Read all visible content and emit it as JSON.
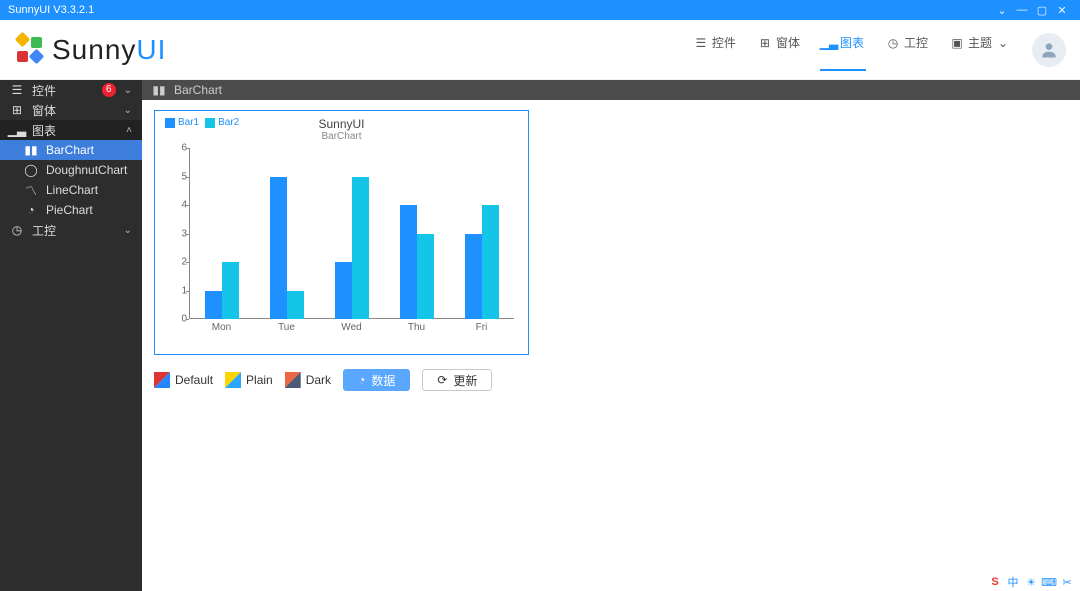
{
  "titlebar": {
    "title": "SunnyUI V3.3.2.1"
  },
  "logo": {
    "text1": "Sunny",
    "text2": "UI"
  },
  "topnav": {
    "items": [
      {
        "label": "控件",
        "icon": "grid-icon"
      },
      {
        "label": "窗体",
        "icon": "window-icon"
      },
      {
        "label": "图表",
        "icon": "chart-icon",
        "active": true
      },
      {
        "label": "工控",
        "icon": "gauge-icon"
      },
      {
        "label": "主题",
        "icon": "image-icon",
        "dropdown": true
      }
    ]
  },
  "sidebar": {
    "groups": [
      {
        "label": "控件",
        "icon": "grid-icon",
        "badge": "6",
        "expand": "⌄"
      },
      {
        "label": "窗体",
        "icon": "window-icon",
        "expand": "⌄"
      },
      {
        "label": "图表",
        "icon": "chart-icon",
        "expand": "˄",
        "open": true,
        "children": [
          {
            "label": "BarChart",
            "icon": "bar-icon",
            "active": true
          },
          {
            "label": "DoughnutChart",
            "icon": "doughnut-icon"
          },
          {
            "label": "LineChart",
            "icon": "line-icon"
          },
          {
            "label": "PieChart",
            "icon": "pie-icon"
          }
        ]
      },
      {
        "label": "工控",
        "icon": "gauge-icon",
        "expand": "⌄"
      }
    ]
  },
  "breadcrumb": {
    "label": "BarChart"
  },
  "chart_data": {
    "type": "bar",
    "title": "SunnyUI",
    "subtitle": "BarChart",
    "categories": [
      "Mon",
      "Tue",
      "Wed",
      "Thu",
      "Fri"
    ],
    "series": [
      {
        "name": "Bar1",
        "color": "#1e90ff",
        "values": [
          1,
          5,
          2,
          4,
          3
        ]
      },
      {
        "name": "Bar2",
        "color": "#15c5e8",
        "values": [
          2,
          1,
          5,
          3,
          4
        ]
      }
    ],
    "ylim": [
      0,
      6
    ],
    "yticks": [
      0,
      1,
      2,
      3,
      4,
      5,
      6
    ],
    "xlabel": "",
    "ylabel": ""
  },
  "styles": {
    "default": "Default",
    "plain": "Plain",
    "dark": "Dark"
  },
  "buttons": {
    "data": "数据",
    "refresh": "更新"
  },
  "taskbar": {
    "glyphs": [
      "S",
      "中",
      "☀",
      "⌨",
      "✂"
    ]
  }
}
